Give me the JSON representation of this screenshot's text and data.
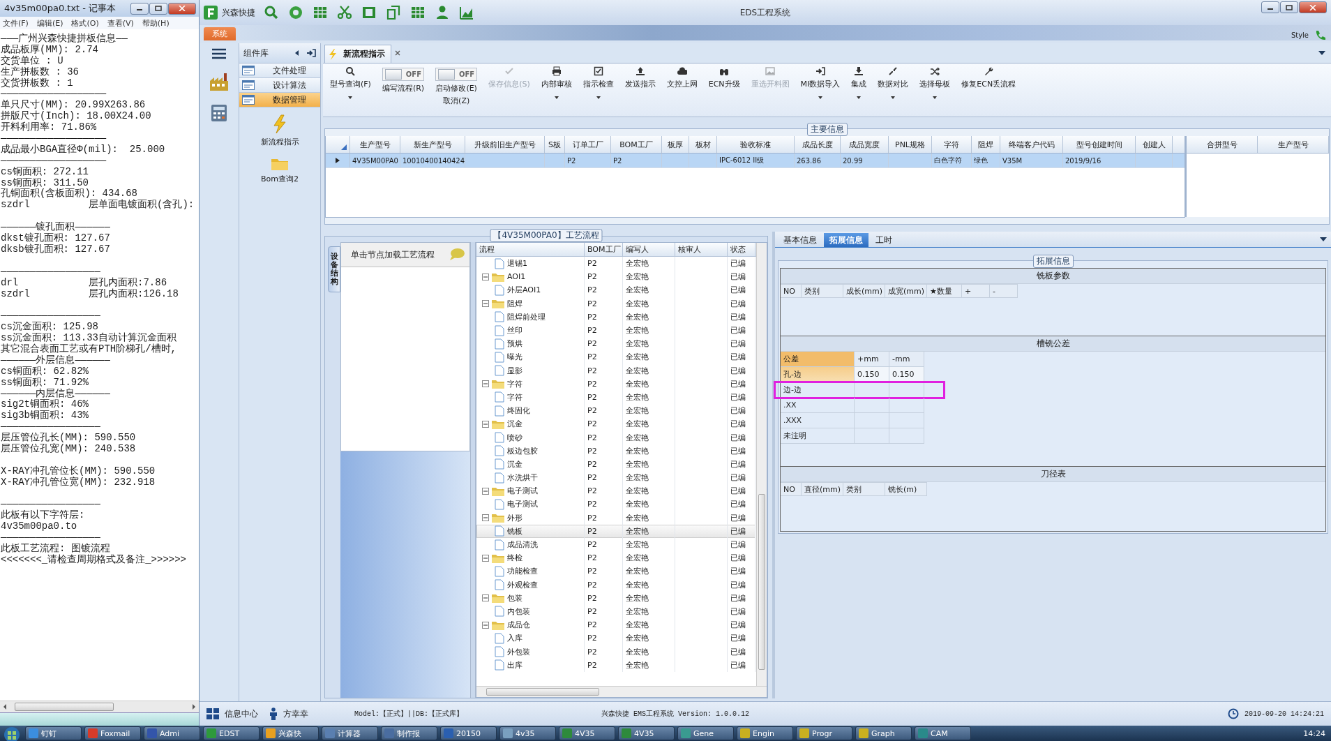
{
  "notepad": {
    "title": "4v35m00pa0.txt - 记事本",
    "menu": [
      "文件(F)",
      "编辑(E)",
      "格式(O)",
      "查看(V)",
      "帮助(H)"
    ],
    "lines": [
      "———广州兴森快捷拼板信息——",
      "成品板厚(MM): 2.74",
      "交货单位 : U",
      "生产拼板数 : 36",
      "交货拼板数 : 1",
      "——————————————————",
      "单只尺寸(MM): 20.99X263.86",
      "拼版尺寸(Inch): 18.00X24.00",
      "开料利用率: 71.86%",
      "——————————————————",
      "成品最小BGA直径Φ(mil):  25.000",
      "——————————————————",
      "cs铜面积: 272.11",
      "ss铜面积: 311.50",
      "孔铜面积(含板面积): 434.68",
      {
        "text": "szdrl          层单面电镀面积(含孔):",
        "blank_after": true
      },
      "——————镀孔面积——————",
      "dkst镀孔面积: 127.67",
      {
        "text": "dksb镀孔面积: 127.67",
        "blank_after": true
      },
      "—————————————————",
      "drl            层孔内面积:7.86",
      {
        "text": "szdrl          层孔内面积:126.18",
        "blank_after": true
      },
      "—————————————————",
      "cs沉金面积: 125.98",
      "ss沉金面积: 113.33自动计算沉金面积",
      "其它混合表面工艺或有PTH阶梯孔/槽时,",
      "——————外层信息——————",
      "cs铜面积: 62.82%",
      "ss铜面积: 71.92%",
      "——————内层信息——————",
      "sig2t铜面积: 46%",
      "sig3b铜面积: 43%",
      "—————————————————",
      "层压管位孔长(MM): 590.550",
      {
        "text": "层压管位孔宽(MM): 240.538",
        "blank_after": true
      },
      "X-RAY冲孔管位长(MM): 590.550",
      {
        "text": "X-RAY冲孔管位宽(MM): 232.918",
        "blank_after": true
      },
      "—————————————————",
      "此板有以下字符层:",
      "4v35m00pa0.to",
      "—————————————————",
      "此板工艺流程: 图镀流程",
      "<<<<<<<_请检查周期格式及备注_>>>>>>"
    ]
  },
  "app": {
    "brand": "兴森快捷",
    "title": "EDS工程系统",
    "system_tab": "系统",
    "style_label": "Style"
  },
  "components": {
    "title": "组件库",
    "items": [
      {
        "label": "文件处理",
        "selected": false
      },
      {
        "label": "设计算法",
        "selected": false
      },
      {
        "label": "数据管理",
        "selected": true
      }
    ],
    "tools": [
      {
        "label": "新流程指示",
        "kind": "flash"
      },
      {
        "label": "Bom查询2",
        "kind": "folder"
      }
    ]
  },
  "doc_tab": {
    "label": "新流程指示"
  },
  "ribbon": [
    {
      "kind": "button",
      "label": "型号查询(F)",
      "disabled": false,
      "dropdown": true
    },
    {
      "kind": "toggle",
      "label": "编写流程(R)",
      "on": false,
      "state_text": "OFF"
    },
    {
      "kind": "toggle",
      "label": "启动修改(E)",
      "sublabel": "取消(Z)",
      "on": false,
      "state_text": "OFF"
    },
    {
      "kind": "button",
      "label": "保存信息(S)",
      "disabled": true,
      "dropdown": false
    },
    {
      "kind": "button",
      "label": "内部审核",
      "disabled": false,
      "dropdown": true
    },
    {
      "kind": "button",
      "label": "指示检查",
      "disabled": false,
      "dropdown": true
    },
    {
      "kind": "button",
      "label": "发送指示",
      "disabled": false,
      "dropdown": false
    },
    {
      "kind": "button",
      "label": "文控上网",
      "disabled": false,
      "dropdown": false
    },
    {
      "kind": "button",
      "label": "ECN升级",
      "disabled": false,
      "dropdown": false
    },
    {
      "kind": "button",
      "label": "重选开料图",
      "disabled": true,
      "dropdown": false
    },
    {
      "kind": "button",
      "label": "MI数据导入",
      "disabled": false,
      "dropdown": true
    },
    {
      "kind": "button",
      "label": "集成",
      "disabled": false,
      "dropdown": true
    },
    {
      "kind": "button",
      "label": "数据对比",
      "disabled": false,
      "dropdown": true
    },
    {
      "kind": "button",
      "label": "选择母板",
      "disabled": false,
      "dropdown": true
    },
    {
      "kind": "button",
      "label": "修复ECN丢流程",
      "disabled": false,
      "dropdown": false
    }
  ],
  "main_info": {
    "title": "主要信息",
    "columns": [
      "生产型号",
      "新生产型号",
      "升级前旧生产型号",
      "S板",
      "订单工厂",
      "BOM工厂",
      "板厚",
      "板材",
      "验收标准",
      "成品长度",
      "成品宽度",
      "PNL规格",
      "字符",
      "阻焊",
      "终端客户代码",
      "型号创建时间",
      "创建人"
    ],
    "rows": [
      {
        "selected": true,
        "cells": [
          "4V35M00PA0",
          "10010400140424",
          null,
          null,
          "P2",
          "P2",
          null,
          null,
          "IPC-6012 II级",
          "263.86",
          "20.99",
          null,
          "白色字符",
          "绿色",
          "V35M",
          "2019/9/16",
          null
        ]
      }
    ],
    "side_columns": [
      "合拼型号",
      "生产型号"
    ]
  },
  "flow": {
    "title": "【4V35M00PA0】工艺流程",
    "side_tab": "设备结构",
    "hint": "单击节点加载工艺流程",
    "columns": [
      "流程",
      "BOM工厂",
      "编写人",
      "核审人",
      "状态"
    ],
    "rows": [
      {
        "children": [
          {
            "name": "退锡1",
            "bom": "P2",
            "writer": "全宏艳",
            "status": "已编",
            "selected": false
          }
        ]
      },
      {
        "name": "AOI1",
        "bom": "P2",
        "writer": "全宏艳",
        "status": "已编",
        "selected": false,
        "expanded": true,
        "children": [
          {
            "name": "外层AOI1",
            "bom": "P2",
            "writer": "全宏艳",
            "status": "已编",
            "selected": false
          }
        ]
      },
      {
        "name": "阻焊",
        "bom": "P2",
        "writer": "全宏艳",
        "status": "已编",
        "selected": false,
        "expanded": true,
        "children": [
          {
            "name": "阻焊前处理",
            "bom": "P2",
            "writer": "全宏艳",
            "status": "已编",
            "selected": false
          },
          {
            "name": "丝印",
            "bom": "P2",
            "writer": "全宏艳",
            "status": "已编",
            "selected": false
          },
          {
            "name": "预烘",
            "bom": "P2",
            "writer": "全宏艳",
            "status": "已编",
            "selected": false
          },
          {
            "name": "曝光",
            "bom": "P2",
            "writer": "全宏艳",
            "status": "已编",
            "selected": false
          },
          {
            "name": "显影",
            "bom": "P2",
            "writer": "全宏艳",
            "status": "已编",
            "selected": false
          }
        ]
      },
      {
        "name": "字符",
        "bom": "P2",
        "writer": "全宏艳",
        "status": "已编",
        "selected": false,
        "expanded": true,
        "children": [
          {
            "name": "字符",
            "bom": "P2",
            "writer": "全宏艳",
            "status": "已编",
            "selected": false
          },
          {
            "name": "终固化",
            "bom": "P2",
            "writer": "全宏艳",
            "status": "已编",
            "selected": false
          }
        ]
      },
      {
        "name": "沉金",
        "bom": "P2",
        "writer": "全宏艳",
        "status": "已编",
        "selected": false,
        "expanded": true,
        "children": [
          {
            "name": "喷砂",
            "bom": "P2",
            "writer": "全宏艳",
            "status": "已编",
            "selected": false
          },
          {
            "name": "板边包胶",
            "bom": "P2",
            "writer": "全宏艳",
            "status": "已编",
            "selected": false
          },
          {
            "name": "沉金",
            "bom": "P2",
            "writer": "全宏艳",
            "status": "已编",
            "selected": false
          },
          {
            "name": "水洗烘干",
            "bom": "P2",
            "writer": "全宏艳",
            "status": "已编",
            "selected": false
          }
        ]
      },
      {
        "name": "电子测试",
        "bom": "P2",
        "writer": "全宏艳",
        "status": "已编",
        "selected": false,
        "expanded": true,
        "children": [
          {
            "name": "电子测试",
            "bom": "P2",
            "writer": "全宏艳",
            "status": "已编",
            "selected": false
          }
        ]
      },
      {
        "name": "外形",
        "bom": "P2",
        "writer": "全宏艳",
        "status": "已编",
        "selected": false,
        "expanded": true,
        "children": [
          {
            "name": "铣板",
            "bom": "P2",
            "writer": "全宏艳",
            "status": "已编",
            "selected": true
          },
          {
            "name": "成品清洗",
            "bom": "P2",
            "writer": "全宏艳",
            "status": "已编",
            "selected": false
          }
        ]
      },
      {
        "name": "终检",
        "bom": "P2",
        "writer": "全宏艳",
        "status": "已编",
        "selected": false,
        "expanded": true,
        "children": [
          {
            "name": "功能检查",
            "bom": "P2",
            "writer": "全宏艳",
            "status": "已编",
            "selected": false
          },
          {
            "name": "外观检查",
            "bom": "P2",
            "writer": "全宏艳",
            "status": "已编",
            "selected": false
          }
        ]
      },
      {
        "name": "包装",
        "bom": "P2",
        "writer": "全宏艳",
        "status": "已编",
        "selected": false,
        "expanded": true,
        "children": [
          {
            "name": "内包装",
            "bom": "P2",
            "writer": "全宏艳",
            "status": "已编",
            "selected": false
          }
        ]
      },
      {
        "name": "成品仓",
        "bom": "P2",
        "writer": "全宏艳",
        "status": "已编",
        "selected": false,
        "expanded": true,
        "children": [
          {
            "name": "入库",
            "bom": "P2",
            "writer": "全宏艳",
            "status": "已编",
            "selected": false
          },
          {
            "name": "外包装",
            "bom": "P2",
            "writer": "全宏艳",
            "status": "已编",
            "selected": false
          },
          {
            "name": "出库",
            "bom": "P2",
            "writer": "全宏艳",
            "status": "已编",
            "selected": false
          }
        ]
      }
    ]
  },
  "detail": {
    "tabs": [
      {
        "label": "基本信息",
        "selected": false
      },
      {
        "label": "拓展信息",
        "selected": true
      },
      {
        "label": "工时",
        "selected": false
      }
    ],
    "group_title": "拓展信息",
    "milling": {
      "title": "铣板参数",
      "columns": [
        "NO",
        "类别",
        "成长(mm)",
        "成宽(mm)",
        "★数量",
        "+",
        "-"
      ]
    },
    "tolerance": {
      "title": "槽铣公差",
      "columns": [
        "公差",
        "+mm",
        "-mm"
      ],
      "rows": [
        {
          "label": "孔-边",
          "plus": "0.150",
          "minus": "0.150",
          "selected": true,
          "annotated": false
        },
        {
          "label": "边-边",
          "selected": false,
          "annotated": true
        },
        {
          "label": ".XX",
          "selected": false,
          "annotated": false
        },
        {
          "label": ".XXX",
          "selected": false,
          "annotated": false
        },
        {
          "label": "未注明",
          "selected": false,
          "annotated": false
        }
      ]
    },
    "cutter": {
      "title": "刀径表",
      "columns": [
        "NO",
        "直径(mm)",
        "类别",
        "铣长(m)"
      ]
    }
  },
  "status_bar": {
    "info_center": "信息中心",
    "user": "方幸幸",
    "model": "Model:【正式】||DB:【正式库】",
    "version": "兴森快捷 EMS工程系统 Version: 1.0.0.12",
    "datetime": "2019-09-20 14:24:21"
  },
  "taskbar": {
    "items": [
      "钉钉",
      "Foxmail",
      "Admi",
      "EDST",
      "兴森快",
      "计算器",
      "制作报",
      "20150",
      "4v35",
      "4V35",
      "4V35",
      "Gene",
      "Engin",
      "Progr",
      "Graph",
      "CAM"
    ],
    "clock": "14:24"
  }
}
